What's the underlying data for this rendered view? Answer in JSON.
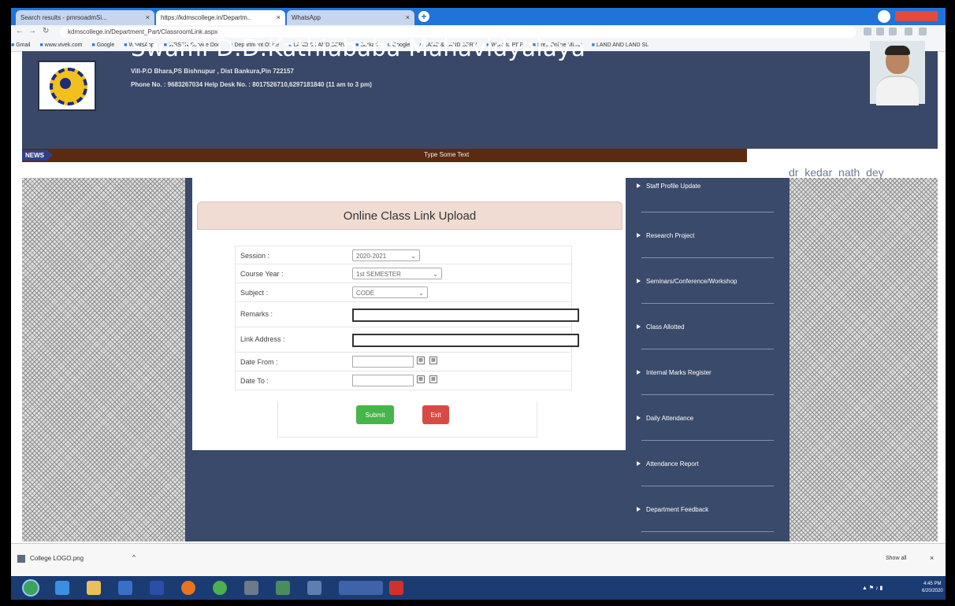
{
  "browser": {
    "tabs": [
      {
        "title": "Search results - pmrsoadmSi...",
        "close": "×"
      },
      {
        "title": "https://kdmscollege.in/Departm...",
        "close": "×"
      },
      {
        "title": "WhatsApp",
        "close": "×"
      }
    ],
    "new_tab": "+",
    "url": "kdmscollege.in/Department_Part/ClassroomLink.aspx",
    "bookmarks": [
      "Gmail",
      "www.vivek.com",
      "Google",
      "WhatsApp",
      "WBSSN Service Doc",
      "Department Office",
      "LAND & LAND SERV",
      "Sarkari",
      "Google",
      "LAND & LAND SERV",
      "Word to PDF",
      "Free Online Mirror",
      "LAND AND LAND SL"
    ]
  },
  "site": {
    "title": "Swami D.D.Kathiababa Mahavidyalaya",
    "address_line": "Vill-P.O Bhara,PS Bishnupur , Dist Bankura,Pin 722157",
    "phone_line": "Phone No. : 9683267034     Help Desk No. : 8017526710,6297181840 (11 am to 3 pm)"
  },
  "news": {
    "label": "NEWS",
    "text": "Type Some Text"
  },
  "user": {
    "name": "dr_kedar_nath_dey"
  },
  "form": {
    "title": "Online Class Link Upload",
    "fields": [
      {
        "label": "Session :",
        "type": "select",
        "value": "2020-2021"
      },
      {
        "label": "Course Year :",
        "type": "select",
        "value": "1st SEMESTER"
      },
      {
        "label": "Subject :",
        "type": "select",
        "value": "CODE"
      },
      {
        "label": "Remarks :",
        "type": "text",
        "value": ""
      },
      {
        "label": "Link Address :",
        "type": "text",
        "value": ""
      },
      {
        "label": "Date From :",
        "type": "date",
        "value": ""
      },
      {
        "label": "Date To :",
        "type": "date",
        "value": ""
      }
    ],
    "submit_label": "Submit",
    "exit_label": "Exit"
  },
  "sidemenu": {
    "items": [
      "Staff Profile Update",
      "Research Project",
      "Seminars/Conference/Workshop",
      "Class Allotted",
      "Internal Marks Register",
      "Daily Attendance",
      "Attendance Report",
      "Department Feedback"
    ]
  },
  "downloads": {
    "file": "College LOGO.png",
    "caret": "^",
    "show_all": "Show all",
    "close": "×"
  },
  "taskbar": {
    "clock_time": "4:45 PM",
    "clock_date": "6/20/2020"
  },
  "colors": {
    "header_bg": "#394868",
    "news_bg": "#5b2a10",
    "card_title_bg": "#f1dcd3",
    "submit_green": "#47b549",
    "exit_red": "#d84b45"
  }
}
